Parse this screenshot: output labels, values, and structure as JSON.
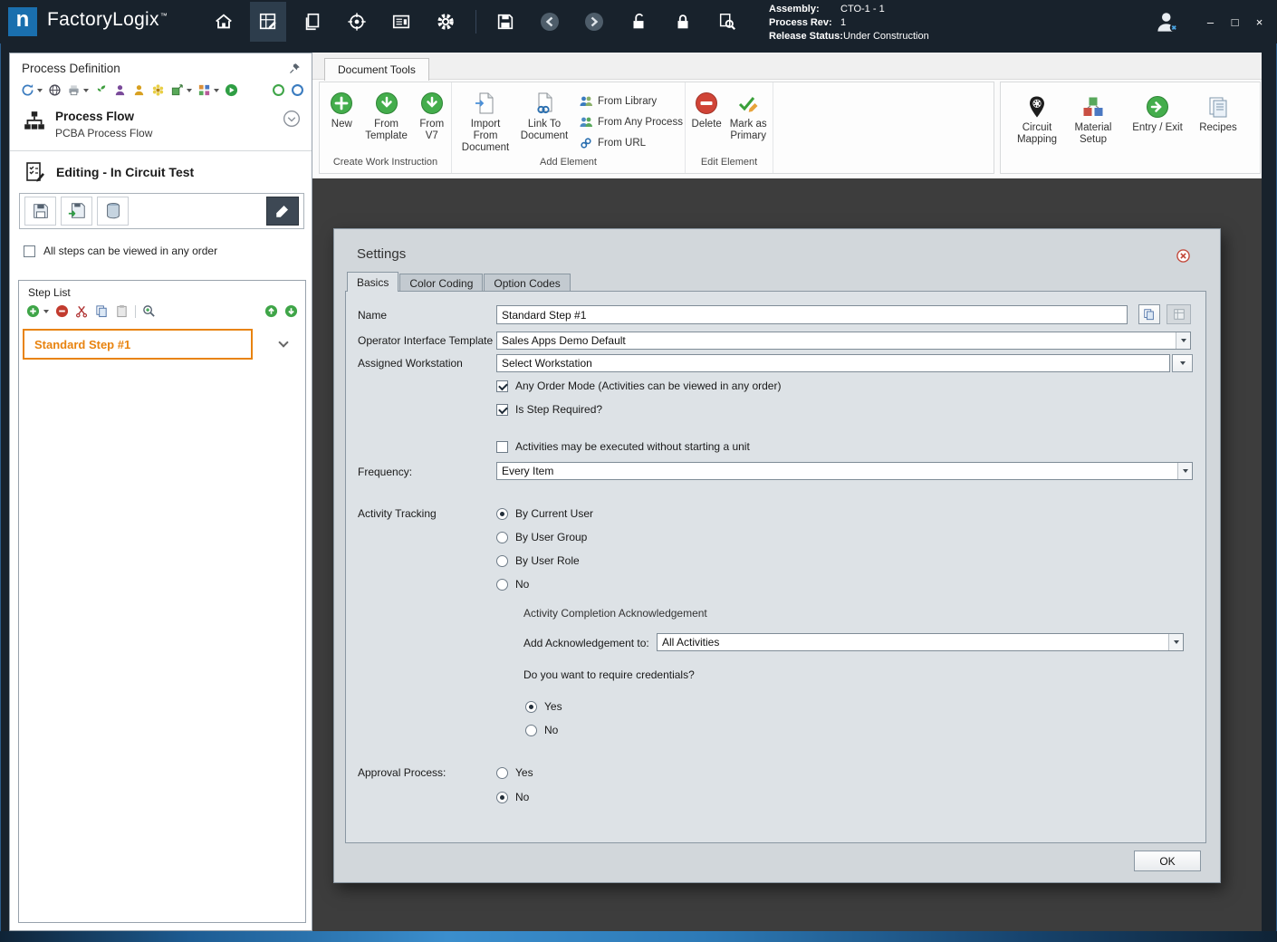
{
  "icons": {
    "minimize": "–",
    "maximize": "□",
    "close": "×"
  },
  "titlebar": {
    "brand": "FactoryLogix",
    "trademark": "™",
    "info": {
      "assembly_label": "Assembly:",
      "assembly_value": "CTO-1 - 1",
      "process_rev_label": "Process Rev:",
      "process_rev_value": "1",
      "release_status_label": "Release Status:",
      "release_status_value": "Under Construction"
    }
  },
  "left_panel": {
    "title": "Process Definition",
    "process_flow_title": "Process Flow",
    "process_flow_subtitle": "PCBA Process Flow",
    "editing_label": "Editing - In Circuit Test",
    "order_checkbox_label": "All steps can be viewed in any order",
    "step_list_title": "Step List",
    "steps": [
      {
        "label": "Standard Step #1"
      }
    ]
  },
  "ribbon": {
    "tab_label": "Document Tools",
    "groups": [
      {
        "label": "Create Work Instruction"
      },
      {
        "label": "Add Element"
      },
      {
        "label": "Edit Element"
      }
    ],
    "buttons": {
      "new": "New",
      "from_template": "From Template",
      "from_v7": "From V7",
      "import_from_document": "Import From Document",
      "link_to_document": "Link To Document",
      "from_library": "From Library",
      "from_any_process": "From Any Process",
      "from_url": "From URL",
      "delete": "Delete",
      "mark_as_primary": "Mark as Primary",
      "circuit_mapping": "Circuit Mapping",
      "material_setup": "Material Setup",
      "entry_exit": "Entry / Exit",
      "recipes": "Recipes"
    }
  },
  "dialog": {
    "title": "Settings",
    "tabs": [
      {
        "label": "Basics"
      },
      {
        "label": "Color Coding"
      },
      {
        "label": "Option Codes"
      }
    ],
    "name_label": "Name",
    "name_value": "Standard Step #1",
    "oit_label": "Operator Interface Template",
    "oit_value": "Sales Apps Demo Default",
    "workstation_label": "Assigned Workstation",
    "workstation_value": "Select Workstation",
    "any_order_label": "Any Order Mode (Activities can be viewed in any order)",
    "step_required_label": "Is Step Required?",
    "no_unit_label": "Activities may be executed without starting a unit",
    "frequency_label": "Frequency:",
    "frequency_value": "Every Item",
    "activity_tracking_label": "Activity Tracking",
    "tracking_options": [
      {
        "label": "By Current User"
      },
      {
        "label": "By User Group"
      },
      {
        "label": "By User Role"
      },
      {
        "label": "No"
      }
    ],
    "ack_section_label": "Activity Completion Acknowledgement",
    "ack_label": "Add Acknowledgement to:",
    "ack_value": "All Activities",
    "credentials_question": "Do you want to require credentials?",
    "credentials_yes": "Yes",
    "credentials_no": "No",
    "approval_label": "Approval Process:",
    "approval_yes": "Yes",
    "approval_no": "No",
    "ok_label": "OK"
  }
}
